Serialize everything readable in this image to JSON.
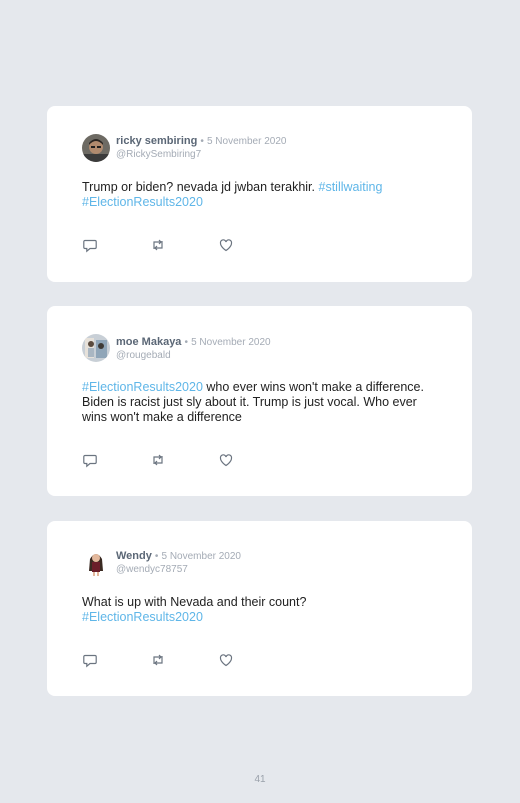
{
  "tweets": [
    {
      "name": "ricky sembiring",
      "separator": "•",
      "date": "5 November 2020",
      "handle": "@RickySembiring7",
      "text": "Trump or biden? nevada jd jwban terakhir.",
      "hashtags": [
        "#stillwaiting",
        "#ElectionResults2020"
      ]
    },
    {
      "name": "moe Makaya",
      "separator": "•",
      "date": "5 November 2020",
      "handle": "@rougebald",
      "lead_hashtag": "#ElectionResults2020",
      "text": "who ever wins won't make a difference. Biden is racist just sly about it. Trump is just vocal. Who ever wins won't make a difference"
    },
    {
      "name": "Wendy",
      "separator": "•",
      "date": "5 November 2020",
      "handle": "@wendyc78757",
      "text": "What is up with Nevada and their count?",
      "hashtags": [
        "#ElectionResults2020"
      ]
    }
  ],
  "icons": {
    "reply": "reply-icon",
    "retweet": "retweet-icon",
    "like": "heart-icon"
  },
  "colors": {
    "background": "#e5e8ed",
    "card": "#ffffff",
    "hashtag": "#5fb6e8",
    "name": "#5b6776",
    "muted": "#a4abb5"
  },
  "page_number": "41"
}
